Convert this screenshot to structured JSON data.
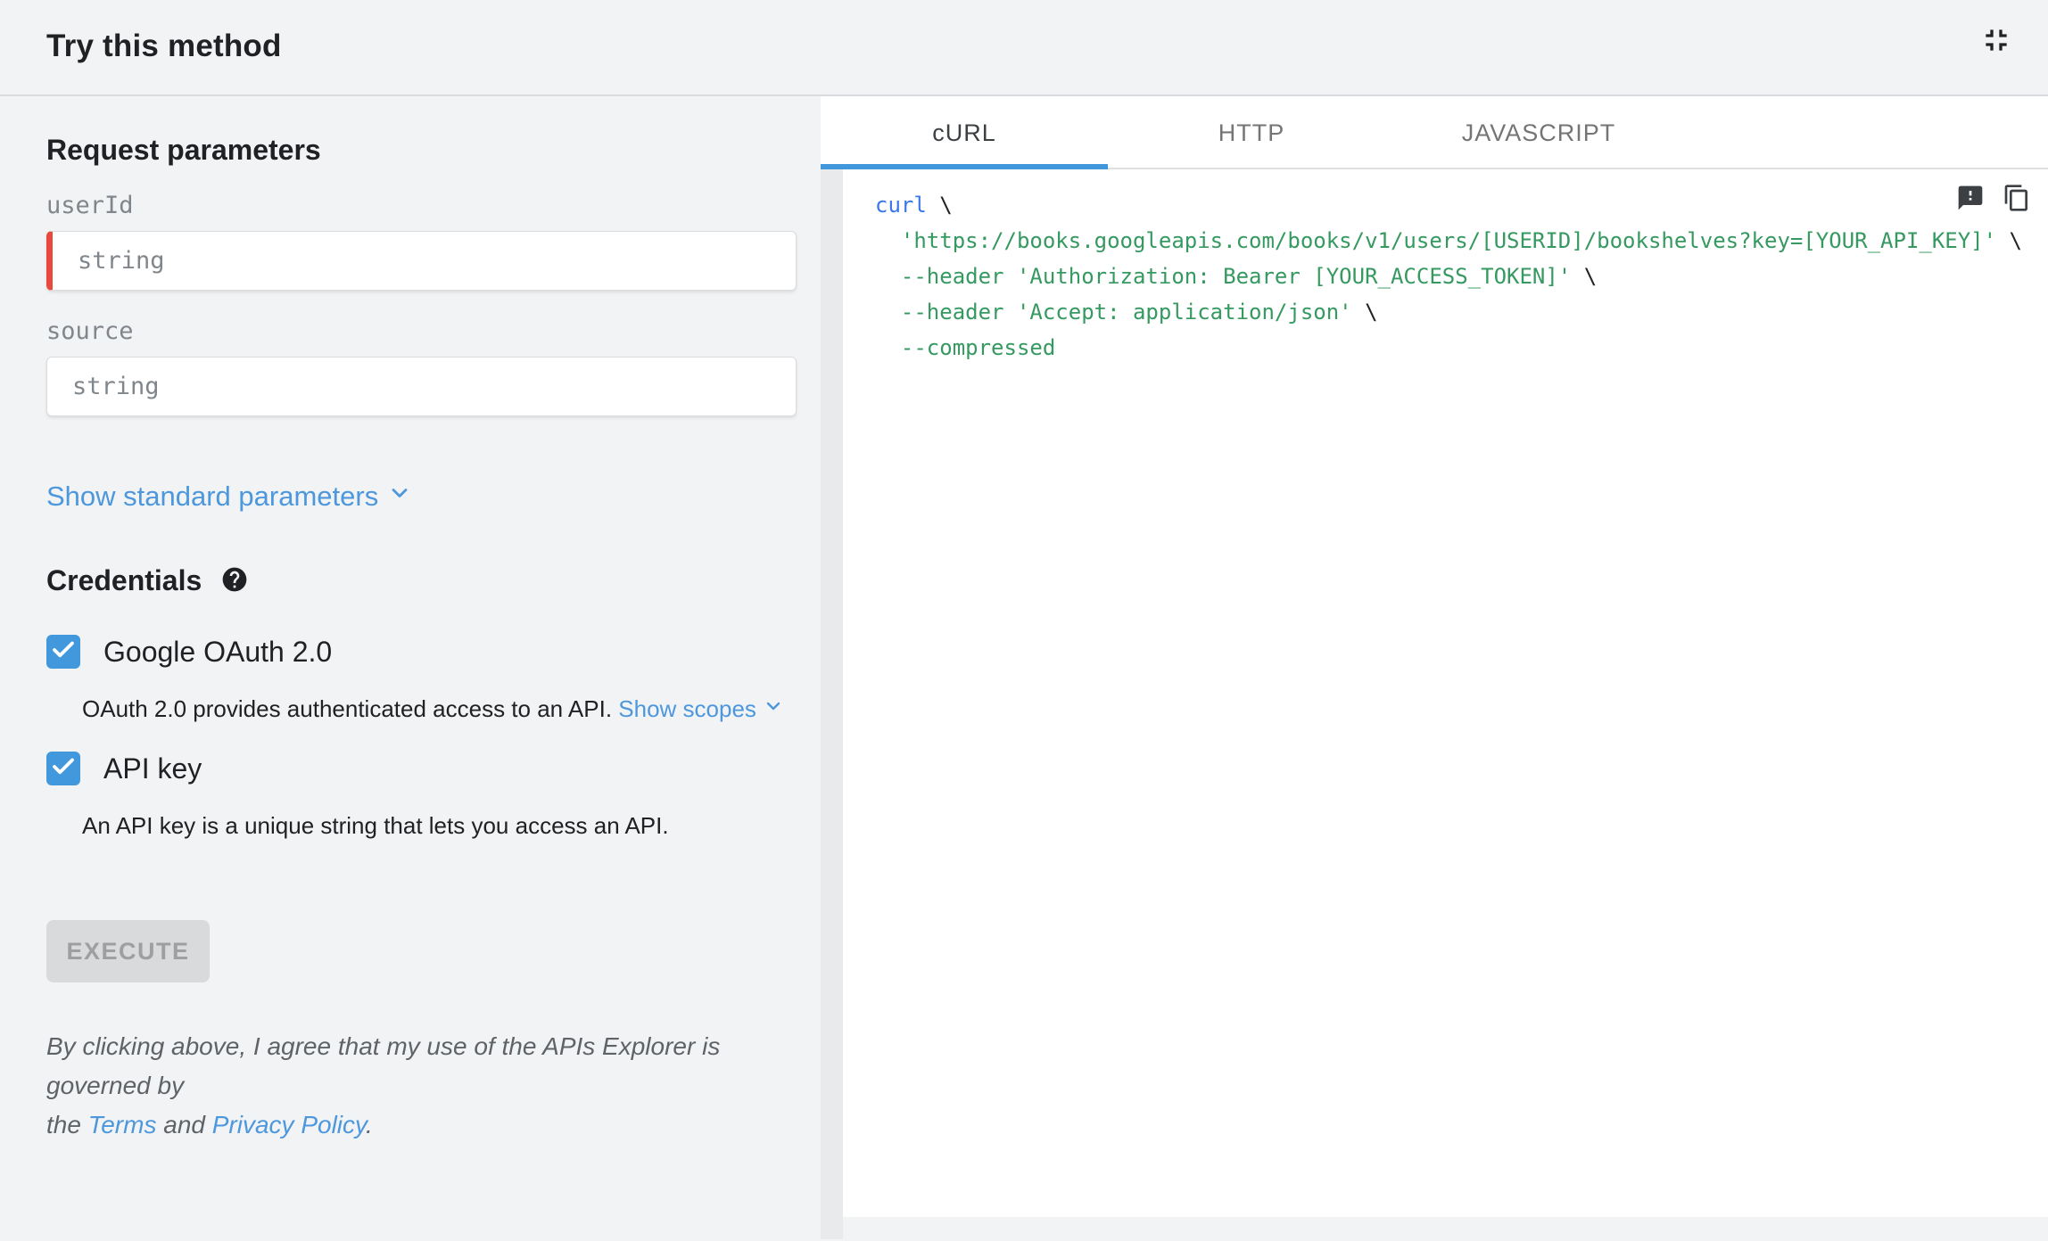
{
  "colors": {
    "background": "#f1f3f4",
    "accent_blue": "#4197dc",
    "link_blue": "#4d97dd",
    "required_red": "#e8493d",
    "code_string_green": "#359960",
    "code_keyword_blue": "#3b78e7",
    "disabled_button_bg": "#d9dadb"
  },
  "header": {
    "title": "Try this method"
  },
  "icons": {
    "collapse": "fullscreen-exit-icon",
    "help": "help-icon",
    "chevron": "chevron-down-icon",
    "feedback": "feedback-icon",
    "copy": "copy-icon"
  },
  "request": {
    "heading": "Request parameters",
    "fields": [
      {
        "label": "userId",
        "placeholder": "string",
        "value": "",
        "required": true
      },
      {
        "label": "source",
        "placeholder": "string",
        "value": "",
        "required": false
      }
    ],
    "show_standard_label": "Show standard parameters"
  },
  "credentials": {
    "heading": "Credentials",
    "oauth": {
      "label": "Google OAuth 2.0",
      "checked": true,
      "description": "OAuth 2.0 provides authenticated access to an API. ",
      "scopes_link": "Show scopes"
    },
    "api_key": {
      "label": "API key",
      "checked": true,
      "description": "An API key is a unique string that lets you access an API."
    }
  },
  "execute": {
    "label": "EXECUTE",
    "disabled": true
  },
  "legal": {
    "line1": "By clicking above, I agree that my use of the APIs Explorer is governed by",
    "line2_prefix": "the ",
    "terms_link": "Terms",
    "line2_middle": " and ",
    "privacy_link": "Privacy Policy",
    "line2_suffix": "."
  },
  "tabs": [
    {
      "label": "cURL",
      "active": true
    },
    {
      "label": "HTTP",
      "active": false
    },
    {
      "label": "JAVASCRIPT",
      "active": false
    }
  ],
  "code": {
    "tokens": [
      {
        "type": "keyword",
        "text": "curl"
      },
      {
        "type": "plain",
        "text": " \\\n"
      },
      {
        "type": "string",
        "text": "  'https://books.googleapis.com/books/v1/users/[USERID]/bookshelves?key=[YOUR_API_KEY]'"
      },
      {
        "type": "plain",
        "text": " \\\n"
      },
      {
        "type": "string",
        "text": "  --header 'Authorization: Bearer [YOUR_ACCESS_TOKEN]'"
      },
      {
        "type": "plain",
        "text": " \\\n"
      },
      {
        "type": "string",
        "text": "  --header 'Accept: application/json'"
      },
      {
        "type": "plain",
        "text": " \\\n"
      },
      {
        "type": "string",
        "text": "  --compressed"
      }
    ]
  }
}
